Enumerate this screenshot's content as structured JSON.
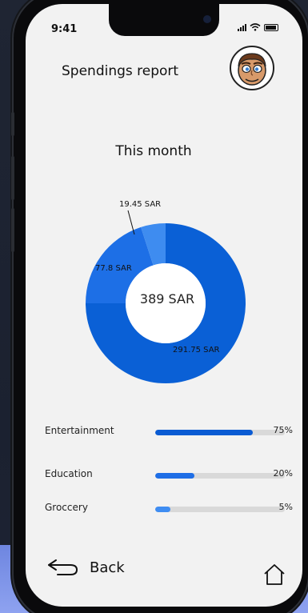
{
  "status_bar": {
    "time": "9:41"
  },
  "header": {
    "title": "Spendings report",
    "avatar_icon": "cartoon-face-avatar"
  },
  "summary": {
    "period_label": "This month",
    "total": "389 SAR"
  },
  "chart_data": {
    "type": "pie",
    "style": "donut",
    "center_label": "389 SAR",
    "slices": [
      {
        "label": "291.75 SAR",
        "value": 291.75,
        "color": "#0a60d6"
      },
      {
        "label": "77.8 SAR",
        "value": 77.8,
        "color": "#1d6fe6"
      },
      {
        "label": "19.45 SAR",
        "value": 19.45,
        "color": "#3e8cf0"
      }
    ]
  },
  "categories": [
    {
      "name": "Entertainment",
      "percent_label": "75%",
      "fill_fraction": 0.75,
      "color": "#0a5bd3"
    },
    {
      "name": "Education",
      "percent_label": "20%",
      "fill_fraction": 0.3,
      "color": "#1f6ee6"
    },
    {
      "name": "Groccery",
      "percent_label": "5%",
      "fill_fraction": 0.12,
      "color": "#3f8df2"
    }
  ],
  "footer": {
    "back_label": "Back",
    "back_icon": "back-arrow-icon",
    "home_icon": "home-icon"
  },
  "colors": {
    "screen_bg": "#f2f2f2",
    "accent": "#0a60d6",
    "track": "#d9d9d9"
  }
}
